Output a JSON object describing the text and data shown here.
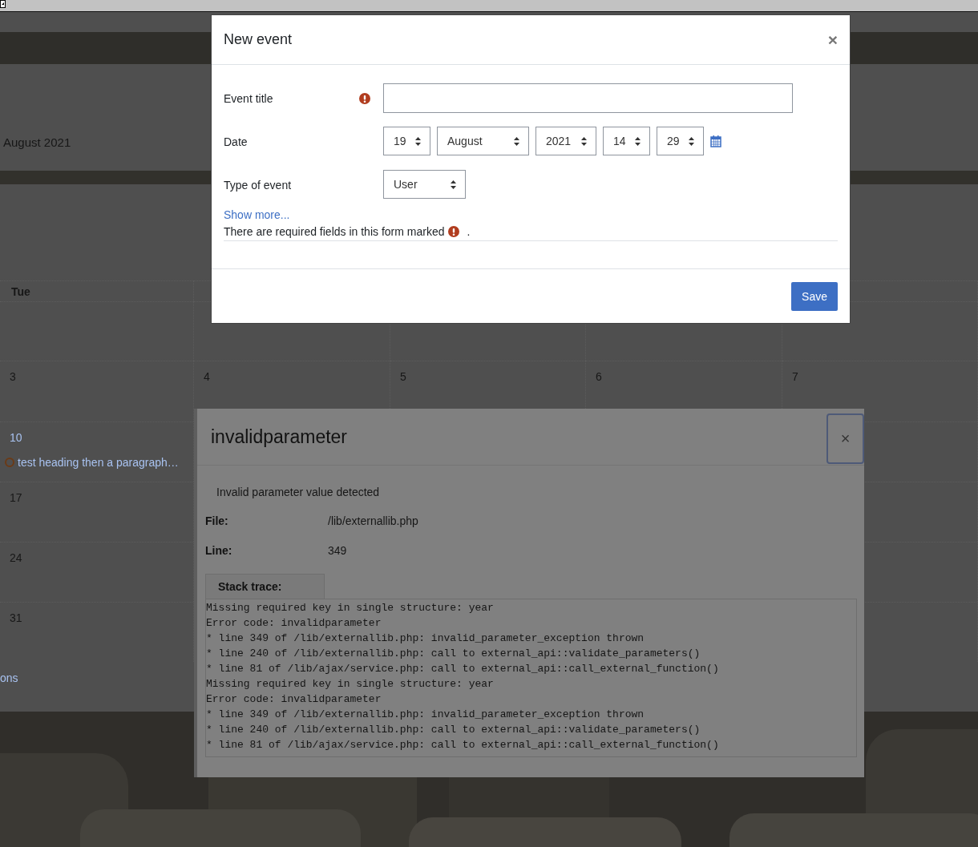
{
  "calendar": {
    "month": "August 2021",
    "weekdays": [
      "Tue"
    ],
    "weeks": [
      {
        "days": [
          {
            "number": "3"
          },
          {
            "number": "4"
          },
          {
            "number": "5"
          },
          {
            "number": "6"
          },
          {
            "number": "7"
          }
        ]
      },
      {
        "days": [
          {
            "number": "10",
            "events": [
              {
                "title": "test heading then a paragraph…"
              }
            ]
          }
        ]
      },
      {
        "days": [
          {
            "number": "17"
          }
        ]
      },
      {
        "days": [
          {
            "number": "24"
          }
        ]
      },
      {
        "days": [
          {
            "number": "31"
          }
        ]
      }
    ],
    "footer_link": "ons"
  },
  "new_event": {
    "title": "New event",
    "close": "×",
    "fields": [
      {
        "kind": "text",
        "label": "Event title",
        "required": true
      },
      {
        "kind": "date",
        "label": "Date",
        "required": false,
        "selects": [
          "19",
          "August",
          "2021",
          "14",
          "29"
        ]
      },
      {
        "kind": "select",
        "label": "Type of event",
        "required": false,
        "selects": [
          "User"
        ]
      }
    ],
    "show_more": "Show more...",
    "required_note": "There are required fields in this form marked",
    "required_note_end": ".",
    "buttons": [
      "Save"
    ]
  },
  "error_dialog": {
    "title": "invalidparameter",
    "close": "×",
    "message": "Invalid parameter value detected",
    "details": [
      {
        "label": "File:",
        "value": "/lib/externallib.php"
      },
      {
        "label": "Line:",
        "value": "349"
      }
    ],
    "stack_tab": "Stack trace:",
    "stack_lines": [
      "Missing required key in single structure: year",
      "Error code: invalidparameter",
      "* line 349 of /lib/externallib.php: invalid_parameter_exception thrown",
      "* line 240 of /lib/externallib.php: call to external_api::validate_parameters()",
      "* line 81 of /lib/ajax/service.php: call to external_api::call_external_function()",
      "Missing required key in single structure: year",
      "Error code: invalidparameter",
      "* line 349 of /lib/externallib.php: invalid_parameter_exception thrown",
      "* line 240 of /lib/externallib.php: call to external_api::validate_parameters()",
      "* line 81 of /lib/ajax/service.php: call to external_api::call_external_function()"
    ]
  }
}
